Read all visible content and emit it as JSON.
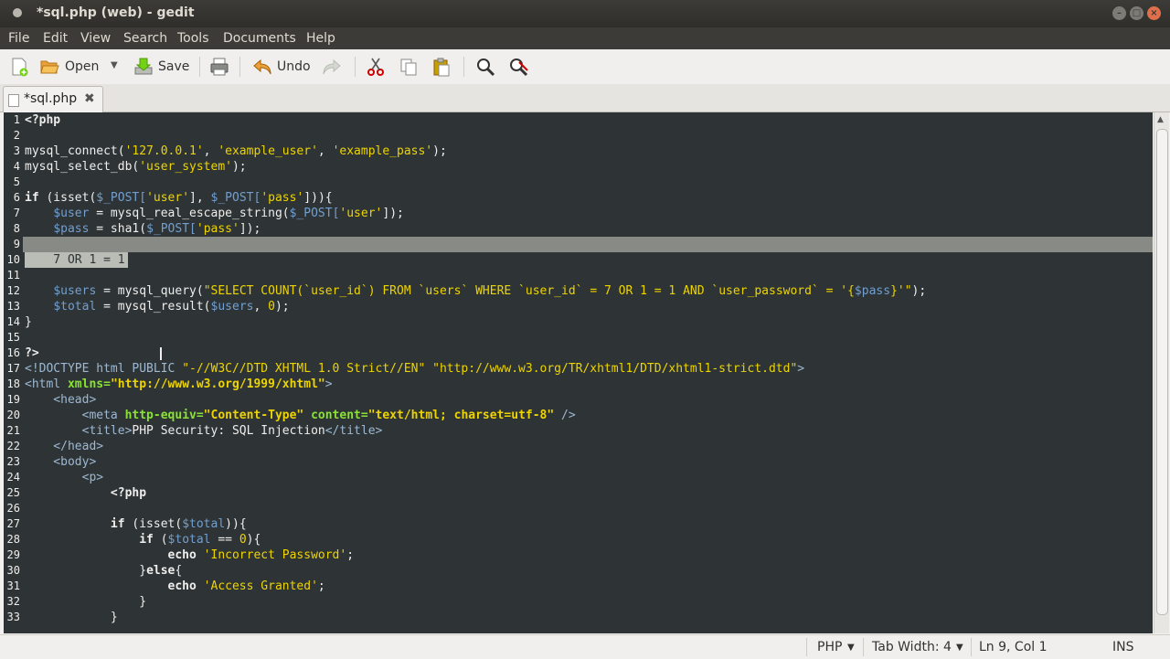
{
  "window": {
    "title": "*sql.php (web) - gedit"
  },
  "menu": [
    "File",
    "Edit",
    "View",
    "Search",
    "Tools",
    "Documents",
    "Help"
  ],
  "toolbar": {
    "open_label": "Open",
    "save_label": "Save",
    "undo_label": "Undo"
  },
  "tab": {
    "label": "*sql.php"
  },
  "status": {
    "language": "PHP",
    "tab_width": "Tab Width: 4",
    "position": "Ln 9, Col 1",
    "mode": "INS"
  },
  "editor": {
    "line_numbers": [
      "1",
      "2",
      "3",
      "4",
      "5",
      "6",
      "7",
      "8",
      "9",
      "10",
      "11",
      "12",
      "13",
      "14",
      "15",
      "16",
      "17",
      "18",
      "19",
      "20",
      "21",
      "22",
      "23",
      "24",
      "25",
      "26",
      "27",
      "28",
      "29",
      "30",
      "31",
      "32",
      "33"
    ],
    "code": {
      "l1": "<?php",
      "l3a": "mysql_connect(",
      "l3b": "'127.0.0.1'",
      "l3c": ", ",
      "l3d": "'example_user'",
      "l3e": ", ",
      "l3f": "'example_pass'",
      "l3g": ");",
      "l4a": "mysql_select_db(",
      "l4b": "'user_system'",
      "l4c": ");",
      "l6a": "if",
      "l6b": " (isset(",
      "l6c": "$_POST[",
      "l6d": "'user'",
      "l6e": "], ",
      "l6f": "$_POST[",
      "l6g": "'pass'",
      "l6h": "])){",
      "l7a": "    ",
      "l7b": "$user",
      "l7c": " = mysql_real_escape_string(",
      "l7d": "$_POST[",
      "l7e": "'user'",
      "l7f": "]);",
      "l8a": "    ",
      "l8b": "$pass",
      "l8c": " = sha1(",
      "l8d": "$_POST[",
      "l8e": "'pass'",
      "l8f": "]);",
      "l10": "    7 OR 1 = 1",
      "l12a": "    ",
      "l12b": "$users",
      "l12c": " = mysql_query(",
      "l12d": "\"SELECT COUNT(`user_id`) FROM `users` WHERE `user_id` = 7 OR 1 = 1 AND `user_password` = '{",
      "l12e": "$pass",
      "l12f": "}'\"",
      "l12g": ");",
      "l13a": "    ",
      "l13b": "$total",
      "l13c": " = mysql_result(",
      "l13d": "$users",
      "l13e": ", ",
      "l13f": "0",
      "l13g": ");",
      "l14": "}",
      "l16": "?>",
      "l17a": "<!DOCTYPE html PUBLIC ",
      "l17b": "\"-//W3C//DTD XHTML 1.0 Strict//EN\" \"http://www.w3.org/TR/xhtml1/DTD/xhtml1-strict.dtd\"",
      "l17c": ">",
      "l18a": "<html ",
      "l18b": "xmlns=",
      "l18c": "\"http://www.w3.org/1999/xhtml\"",
      "l18d": ">",
      "l19": "    <head>",
      "l20a": "        <meta ",
      "l20b": "http-equiv=",
      "l20c": "\"Content-Type\"",
      "l20d": " content=",
      "l20e": "\"text/html; charset=utf-8\"",
      "l20f": " />",
      "l21a": "        <title>",
      "l21b": "PHP Security: SQL Injection",
      "l21c": "</title>",
      "l22": "    </head>",
      "l23": "    <body>",
      "l24": "        <p>",
      "l25": "            <?php",
      "l27a": "            if",
      "l27b": " (isset(",
      "l27c": "$total",
      "l27d": ")){",
      "l28a": "                if",
      "l28b": " (",
      "l28c": "$total",
      "l28d": " == ",
      "l28e": "0",
      "l28f": "){",
      "l29a": "                    echo",
      "l29b": " ",
      "l29c": "'Incorrect Password'",
      "l29d": ";",
      "l30a": "                }",
      "l30b": "else",
      "l30c": "{",
      "l31a": "                    echo",
      "l31b": " ",
      "l31c": "'Access Granted'",
      "l31d": ";",
      "l32": "                }",
      "l33": "            }"
    }
  }
}
